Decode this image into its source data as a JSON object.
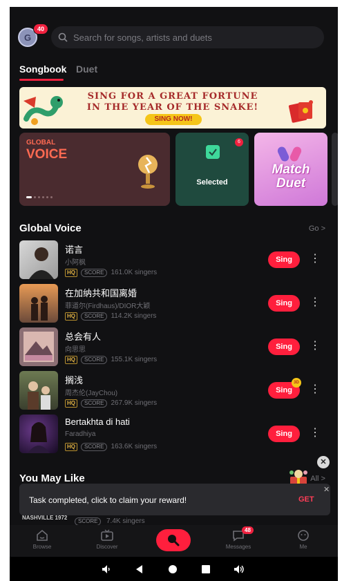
{
  "header": {
    "avatar_initial": "G",
    "avatar_badge": "40",
    "search_placeholder": "Search for songs, artists and duets"
  },
  "tabs": [
    {
      "label": "Songbook",
      "active": true
    },
    {
      "label": "Duet",
      "active": false
    }
  ],
  "banner": {
    "line1": "SING FOR A GREAT FORTUNE",
    "line2": "IN THE YEAR OF THE SNAKE!",
    "cta": "SING NOW!"
  },
  "cards": {
    "global_voice": {
      "line1": "GLOBAL",
      "line2": "VOICE"
    },
    "selected": {
      "label": "Selected",
      "badge": "6"
    },
    "match_duet": {
      "line1": "Match",
      "line2": "Duet"
    }
  },
  "global_voice_section": {
    "title": "Global Voice",
    "link": "Go >",
    "songs": [
      {
        "title": "诺言",
        "artist": "小阿枫",
        "hq": "HQ",
        "score": "SCORE",
        "singers": "161.0K singers",
        "sing": "Sing"
      },
      {
        "title": "在加纳共和国离婚",
        "artist": "菲道尔(Firdhaus)/DIOR大颖",
        "hq": "HQ",
        "score": "SCORE",
        "singers": "114.2K singers",
        "sing": "Sing"
      },
      {
        "title": "总会有人",
        "artist": "向思思",
        "hq": "HQ",
        "score": "SCORE",
        "singers": "155.1K singers",
        "sing": "Sing"
      },
      {
        "title": "搁浅",
        "artist": "周杰伦(JayChou)",
        "hq": "HQ",
        "score": "SCORE",
        "singers": "267.9K singers",
        "sing": "Sing"
      },
      {
        "title": "Bertakhta di hati",
        "artist": "Faradhiya",
        "hq": "HQ",
        "score": "SCORE",
        "singers": "163.6K singers",
        "sing": "Sing"
      }
    ]
  },
  "you_may_like": {
    "title": "You May Like",
    "link": "All >",
    "peek_thumb_text": "NASHVILLE 1972",
    "peek_score": "SCORE",
    "peek_singers": "7.4K singers"
  },
  "toast": {
    "message": "Task completed, click to claim your reward!",
    "action": "GET"
  },
  "bottom_nav": {
    "browse": "Browse",
    "discover": "Discover",
    "messages": "Messages",
    "messages_badge": "48",
    "me": "Me"
  },
  "colors": {
    "accent": "#ff1f3d",
    "background": "#111113",
    "hq": "#e0b143"
  }
}
